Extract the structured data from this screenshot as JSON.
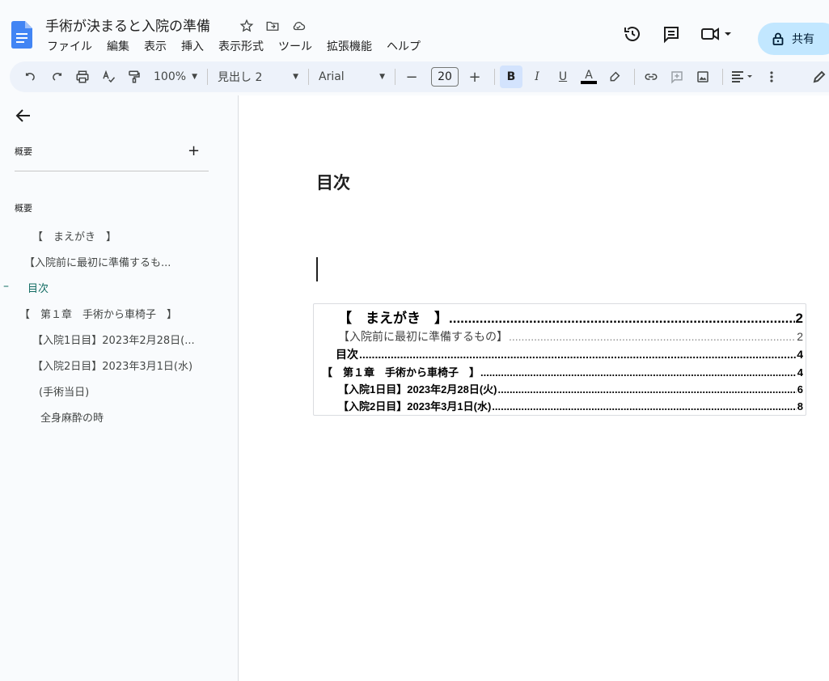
{
  "app": {
    "title": "手術が決まると入院の準備",
    "menu": [
      "ファイル",
      "編集",
      "表示",
      "挿入",
      "表示形式",
      "ツール",
      "拡張機能",
      "ヘルプ"
    ],
    "share_label": "共有",
    "accent_color": "#c2e7ff",
    "icons": {
      "title": [
        "star-icon",
        "move-folder-icon",
        "cloud-status-icon"
      ],
      "right": [
        "version-history-icon",
        "comments-icon",
        "meet-icon"
      ]
    }
  },
  "toolbar": {
    "zoom": "100%",
    "style": "見出し 2",
    "font": "Arial",
    "font_size": "20",
    "minus": "−",
    "plus": "+",
    "bold": "B",
    "italic": "I",
    "underline": "U",
    "text_color": "A"
  },
  "sidebar": {
    "summary_label": "概要",
    "outline_label": "概要",
    "items": [
      {
        "label": "【　まえがき　】",
        "current": false
      },
      {
        "label": "【入院前に最初に準備するも...",
        "current": false
      },
      {
        "label": "目次",
        "current": true
      },
      {
        "label": "【　第１章　手術から車椅子　】",
        "current": false
      },
      {
        "label": "【入院1日目】2023年2月28日(...",
        "current": false
      },
      {
        "label": "【入院2日目】2023年3月1日(水)",
        "current": false
      },
      {
        "label": "(手術当日)",
        "current": false
      },
      {
        "label": "全身麻酔の時",
        "current": false
      }
    ],
    "current_marker": "–"
  },
  "document": {
    "heading": "目次",
    "toc": [
      {
        "title": "【　まえがき　】",
        "page": "2"
      },
      {
        "title": "【入院前に最初に準備するもの】",
        "page": "2"
      },
      {
        "title": "目次",
        "page": "4"
      },
      {
        "title": "【　第１章　手術から車椅子　】",
        "page": "4"
      },
      {
        "title": "【入院1日目】2023年2月28日(火)",
        "page": "6"
      },
      {
        "title": "【入院2日目】2023年3月1日(水)",
        "page": "8"
      }
    ]
  }
}
